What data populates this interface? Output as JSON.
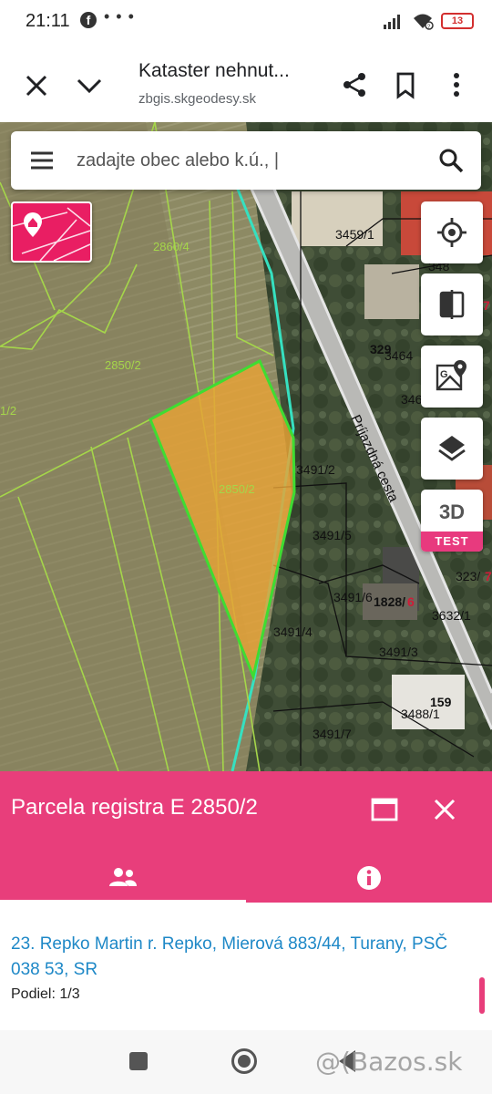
{
  "status_bar": {
    "time": "21:11",
    "fb_icon": "facebook-icon",
    "more_icon": "more-dots",
    "battery": "13"
  },
  "browser": {
    "title": "Kataster nehnut...",
    "url": "zbgis.skgeodesy.sk"
  },
  "search": {
    "placeholder": "zadajte obec alebo k.ú., |"
  },
  "map_buttons": {
    "three_d_label": "3D",
    "three_d_badge": "TEST"
  },
  "map": {
    "road_label": "Príjazdná cesta",
    "parcels": [
      "3459/1",
      "329",
      "3464",
      "3491/2",
      "3491/5",
      "3491/6",
      "1828/",
      "6",
      "3632/1",
      "323/",
      "7",
      "3491/4",
      "3491/3",
      "3488/1",
      "159",
      "3491/7",
      "2850/2",
      "2860/4",
      "1/2",
      "346",
      "348",
      "7"
    ]
  },
  "panel": {
    "title": "Parcela registra E 2850/2",
    "owner": "23. Repko Martin r. Repko, Mierová 883/44, Turany, PSČ 038 53, SR",
    "share": "Podiel: 1/3",
    "accent": "#e83e7b",
    "link_color": "#1e88c7"
  },
  "watermark": "@(Bazos.sk"
}
